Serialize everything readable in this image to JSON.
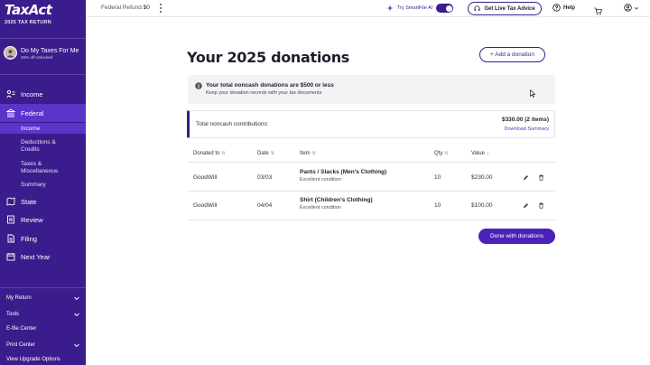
{
  "brand": {
    "logo": "TaxAct",
    "tax_return_label": "2025 TAX RETURN"
  },
  "plan": {
    "name": "Do My Taxes For Me",
    "subtitle": "25% off Unlocked"
  },
  "nav": [
    {
      "label": "Income",
      "icon": "income-icon"
    },
    {
      "label": "Federal",
      "icon": "bank-icon"
    },
    {
      "label": "State",
      "icon": "map-icon"
    },
    {
      "label": "Review",
      "icon": "review-icon"
    },
    {
      "label": "Filing",
      "icon": "filing-icon"
    },
    {
      "label": "Next Year",
      "icon": "calendar-icon"
    }
  ],
  "federal_subnav": [
    {
      "label": "Income"
    },
    {
      "label": "Deductions & Credits"
    },
    {
      "label": "Taxes & Miscellaneous"
    },
    {
      "label": "Summary"
    }
  ],
  "sidebar_bottom": [
    {
      "label": "My Return"
    },
    {
      "label": "Tools"
    },
    {
      "label": "E-file Center"
    },
    {
      "label": "Print Center"
    },
    {
      "label": "View Upgrade Options"
    }
  ],
  "topbar": {
    "refund_label": "Federal Refund",
    "refund_value": "$0",
    "ai_label": "Try SmartFile AI",
    "ai_enabled": true,
    "live_advice": "Get Live Tax Advice",
    "help": "Help"
  },
  "page": {
    "title": "Your 2025 donations",
    "add_button": "+ Add a donation",
    "info_title": "Your total noncash donations are $500 or less",
    "info_sub": "Keep your donation records with your tax documents",
    "total_label": "Total noncash contributions:",
    "total_amount": "$330.00 (2 items)",
    "download": "Download Summary",
    "done_button": "Done with donations"
  },
  "table": {
    "headers": [
      "Donated to",
      "Date",
      "Item",
      "Qty",
      "Value"
    ],
    "rows": [
      {
        "donated_to": "GoodWill",
        "date": "03/03",
        "item": "Pants / Slacks (Men's Clothing)",
        "condition": "Excellent condition",
        "qty": "10",
        "value": "$230.00"
      },
      {
        "donated_to": "GoodWill",
        "date": "04/04",
        "item": "Shirt (Children's Clothing)",
        "condition": "Excellent condition",
        "qty": "10",
        "value": "$100.00"
      }
    ]
  },
  "colors": {
    "brand": "#3b1c8c",
    "accent": "#5b34c9",
    "button": "#4a22b8"
  }
}
